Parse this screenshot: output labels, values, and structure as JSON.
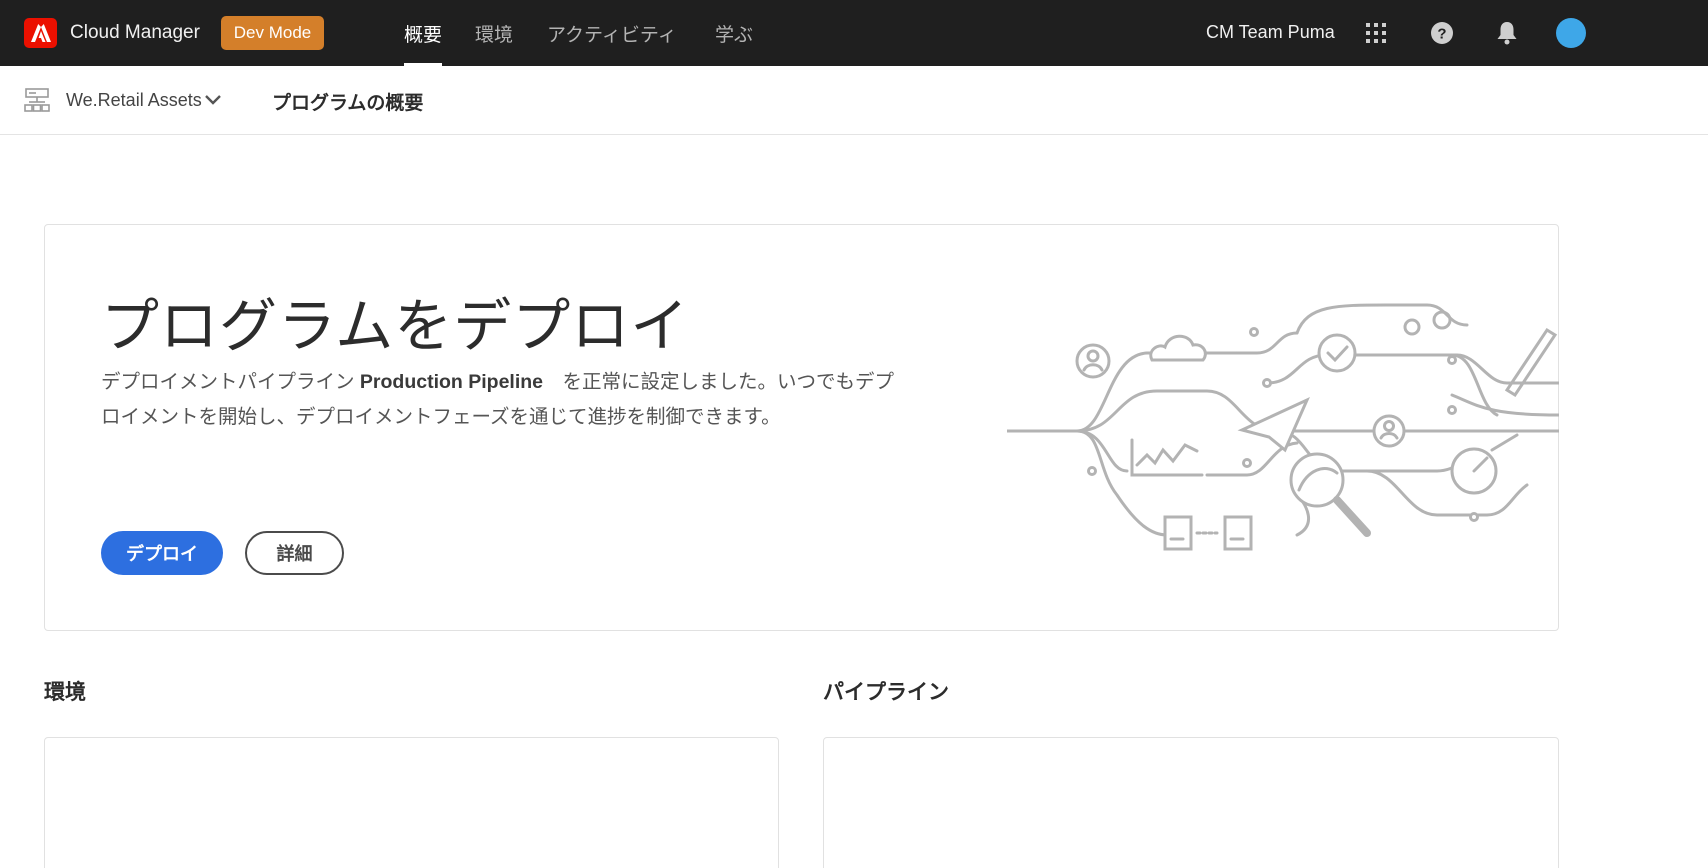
{
  "app": {
    "title": "Cloud Manager",
    "dev_mode_label": "Dev Mode",
    "brand_color": "#eb1000"
  },
  "nav": {
    "tabs": [
      {
        "label": "概要",
        "active": true
      },
      {
        "label": "環境",
        "active": false
      },
      {
        "label": "アクティビティ",
        "active": false
      },
      {
        "label": "学ぶ",
        "active": false
      }
    ],
    "team_name": "CM Team Puma",
    "icons": [
      "apps-grid-icon",
      "help-icon",
      "bell-icon",
      "user-avatar"
    ]
  },
  "subheader": {
    "program_name": "We.Retail Assets",
    "page_title": "プログラムの概要"
  },
  "hero": {
    "title": "プログラムをデプロイ",
    "desc_prefix": "デプロイメントパイプライン ",
    "pipeline_name": "Production Pipeline",
    "desc_suffix": "　を正常に設定しました。いつでもデプロイメントを開始し、デプロイメントフェーズを通じて進捗を制御できます。",
    "deploy_button": "デプロイ",
    "details_button": "詳細",
    "accent_color": "#2d6fe0"
  },
  "sections": {
    "environments_title": "環境",
    "pipelines_title": "パイプライン"
  }
}
